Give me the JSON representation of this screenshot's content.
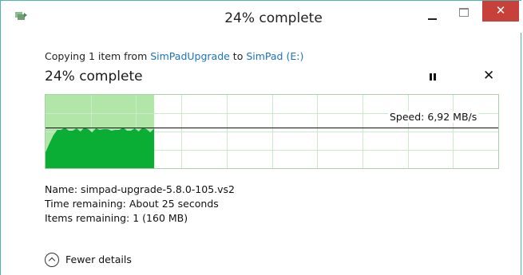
{
  "window": {
    "title": "24% complete"
  },
  "copy": {
    "prefix": "Copying 1 item from ",
    "source": "SimPadUpgrade",
    "middle": " to ",
    "destination": "SimPad (E:)",
    "percent_text": "24% complete",
    "progress": 0.24,
    "speed_label": "Speed: 6,92 MB/s"
  },
  "details": {
    "name": "Name:  simpad-upgrade-5.8.0-105.vs2",
    "time_remaining": "Time remaining:  About 25 seconds",
    "items_remaining": "Items remaining:  1 (160 MB)"
  },
  "footer": {
    "toggle_label": "Fewer details"
  },
  "colors": {
    "progress_fill": "#b2e6a8",
    "speed_area": "#0aae35",
    "grid": "#c9ebca",
    "close": "#c7413a",
    "link": "#1a73c2"
  }
}
